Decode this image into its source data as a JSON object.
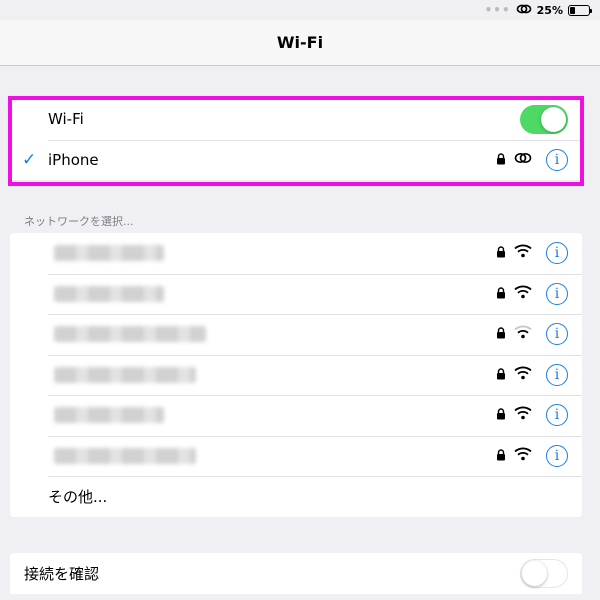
{
  "status_bar": {
    "dots": "•••",
    "battery": "25%",
    "battery_level": 0.25
  },
  "nav": {
    "title": "Wi-Fi"
  },
  "wifi_section": {
    "toggle_label": "Wi-Fi",
    "toggle_on": true,
    "connected_network": "iPhone",
    "check_mark": "✓"
  },
  "networks_header": "ネットワークを選択...",
  "networks": [
    {
      "name_visible": false,
      "locked": true,
      "signal": "strong"
    },
    {
      "name_visible": false,
      "locked": true,
      "signal": "strong"
    },
    {
      "name_visible": false,
      "locked": true,
      "signal": "weak"
    },
    {
      "name_visible": false,
      "locked": true,
      "signal": "strong"
    },
    {
      "name_visible": false,
      "locked": true,
      "signal": "strong"
    },
    {
      "name_visible": false,
      "locked": true,
      "signal": "strong"
    }
  ],
  "other_label": "その他...",
  "confirm": {
    "label": "接続を確認",
    "toggle_on": false
  },
  "info_glyph": "i",
  "colors": {
    "accent": "#1a7de3",
    "toggle_on": "#4cd964",
    "highlight": "#ee10e0",
    "background": "#efeff4"
  }
}
